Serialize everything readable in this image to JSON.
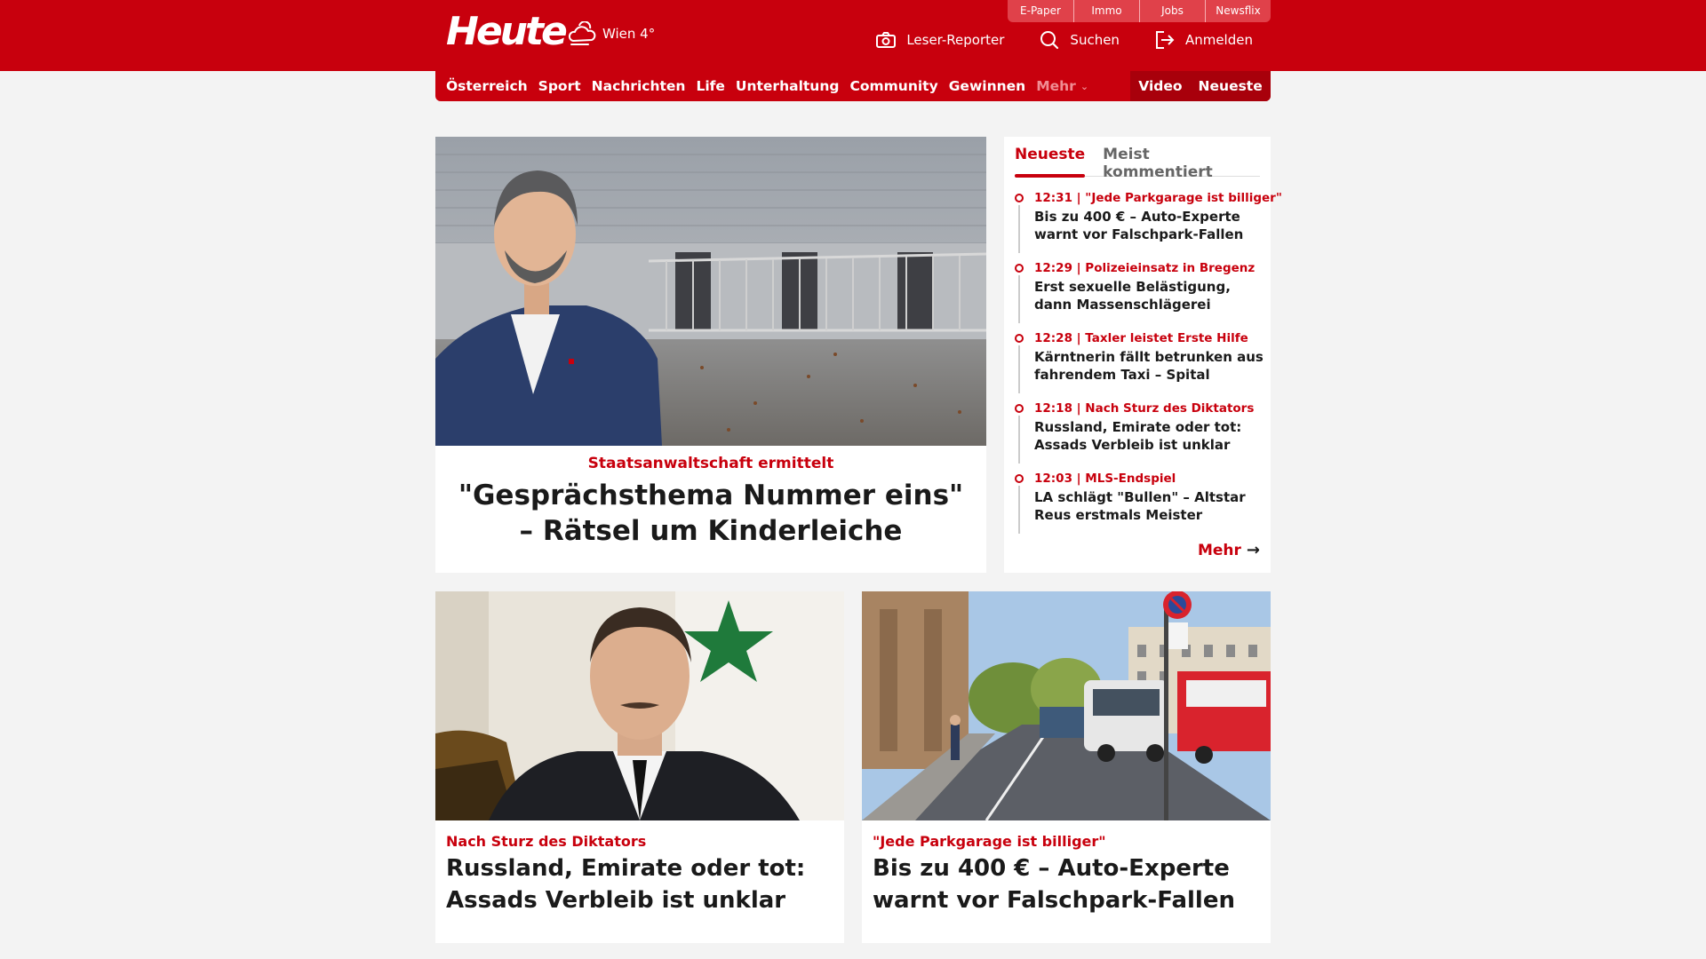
{
  "header": {
    "logo": "Heute",
    "weather": "Wien 4°",
    "utility_links": [
      "E-Paper",
      "Immo",
      "Jobs",
      "Newsflix"
    ],
    "leser_reporter": "Leser-Reporter",
    "search": "Suchen",
    "login": "Anmelden"
  },
  "nav": {
    "items": [
      "Österreich",
      "Sport",
      "Nachrichten",
      "Life",
      "Unterhaltung",
      "Community",
      "Gewinnen"
    ],
    "more": "Mehr",
    "video": "Video",
    "latest": "Neueste"
  },
  "hero": {
    "kicker": "Staatsanwaltschaft ermittelt",
    "title": "\"Gesprächsthema Nummer eins\" – Rätsel um Kinderleiche"
  },
  "sidebar": {
    "tabs": [
      "Neueste",
      "Meist kommentiert"
    ],
    "items": [
      {
        "kicker": "12:31 | \"Jede Parkgarage ist billiger\"",
        "title": "Bis zu 400 € – Auto-Experte warnt vor Falschpark-Fallen"
      },
      {
        "kicker": "12:29 | Polizeieinsatz in Bregenz",
        "title": "Erst sexuelle Belästigung, dann Massenschlägerei"
      },
      {
        "kicker": "12:28 | Taxler leistet Erste Hilfe",
        "title": "Kärntnerin fällt betrunken aus fahrendem Taxi – Spital"
      },
      {
        "kicker": "12:18 | Nach Sturz des Diktators",
        "title": "Russland, Emirate oder tot: Assads Verbleib ist unklar"
      },
      {
        "kicker": "12:03 | MLS-Endspiel",
        "title": "LA schlägt \"Bullen\" – Altstar Reus erstmals Meister"
      }
    ],
    "more": "Mehr"
  },
  "cards": [
    {
      "kicker": "Nach Sturz des Diktators",
      "title": "Russland, Emirate oder tot: Assads Verbleib ist unklar"
    },
    {
      "kicker": "\"Jede Parkgarage ist billiger\"",
      "title": "Bis zu 400 € – Auto-Experte warnt vor Falschpark-Fallen"
    }
  ],
  "colors": {
    "brand": "#c8000d",
    "background": "#f3f3f3"
  }
}
